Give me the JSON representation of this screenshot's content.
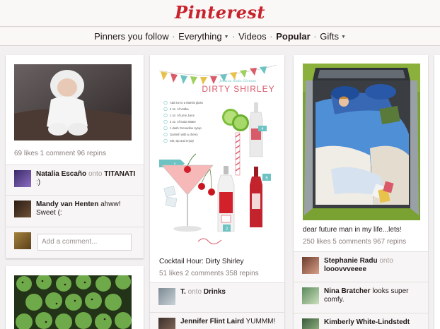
{
  "header": {
    "logo": "Pinterest"
  },
  "nav": {
    "items": [
      {
        "label": "Pinners you follow"
      },
      {
        "label": "Everything"
      },
      {
        "label": "Videos"
      },
      {
        "label": "Popular"
      },
      {
        "label": "Gifts"
      }
    ]
  },
  "pins": {
    "baby": {
      "stats": "69 likes  1 comment  96 repins",
      "comments": [
        {
          "user": "Natalia Escaño",
          "onto": "onto",
          "board": "TITANATI",
          "text": ":)"
        },
        {
          "user": "Mandy van Henten",
          "text": "ahww! Sweet (:"
        }
      ],
      "add_comment_placeholder": "Add a comment..."
    },
    "cocktail": {
      "recipe_title": "DIRTY SHIRLEY",
      "recipe_subtitle": "Jessica Slats Giveaw",
      "ingredients": [
        "Add ice to a Martini glass",
        "2 oz. of Vodka",
        "1 oz. of Lime Juice",
        "2 oz. of Soda Water",
        "1 dash Grenadine syrup",
        "Garnish with a cherry",
        "Stir, sip and enjoy!"
      ],
      "step_numbers": [
        "1",
        "2",
        "3",
        "4",
        "5"
      ],
      "caption": "Cocktail Hour: Dirty Shirley",
      "stats": "51 likes  2 comments  358 repins",
      "comments": [
        {
          "user": "T.",
          "onto": "onto",
          "board": "Drinks",
          "text": ""
        },
        {
          "user": "Jennifer Flint Laird",
          "text": "YUMMM!"
        }
      ]
    },
    "truck": {
      "caption": "dear future man in my life...lets!",
      "stats": "250 likes  5 comments  967 repins",
      "comments": [
        {
          "user": "Stephanie Radu",
          "onto": "onto",
          "board": "looovvveeee",
          "text": ""
        },
        {
          "user": "Nina Bratcher",
          "text": "looks super comfy."
        },
        {
          "user": "Kimberly White-Lindstedt",
          "text": ""
        }
      ]
    }
  }
}
